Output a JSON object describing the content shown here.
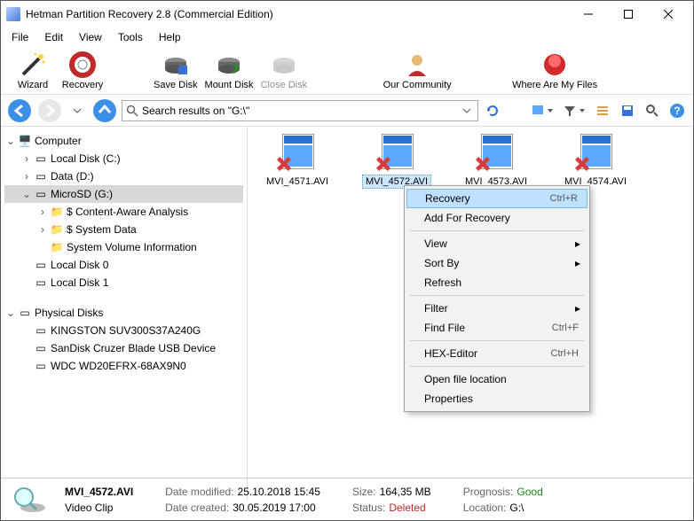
{
  "window": {
    "title": "Hetman Partition Recovery 2.8 (Commercial Edition)"
  },
  "menu": {
    "file": "File",
    "edit": "Edit",
    "view": "View",
    "tools": "Tools",
    "help": "Help"
  },
  "ribbon": {
    "wizard": "Wizard",
    "recovery": "Recovery",
    "savedisk": "Save Disk",
    "mountdisk": "Mount Disk",
    "closedisk": "Close Disk",
    "community": "Our Community",
    "where": "Where Are My Files"
  },
  "address": {
    "text": "Search results on \"G:\\\""
  },
  "tree": {
    "computer": "Computer",
    "localc": "Local Disk (C:)",
    "datad": "Data (D:)",
    "microsd": "MicroSD (G:)",
    "contentaware": "$ Content-Aware Analysis",
    "systemdata": "$ System Data",
    "svi": "System Volume Information",
    "ld0": "Local Disk 0",
    "ld1": "Local Disk 1",
    "physical": "Physical Disks",
    "kingston": "KINGSTON SUV300S37A240G",
    "sandisk": "SanDisk Cruzer Blade USB Device",
    "wdc": "WDC WD20EFRX-68AX9N0"
  },
  "files": [
    {
      "name": "MVI_4571.AVI"
    },
    {
      "name": "MVI_4572.AVI"
    },
    {
      "name": "MVI_4573.AVI"
    },
    {
      "name": "MVI_4574.AVI"
    }
  ],
  "ctx": {
    "recovery": "Recovery",
    "recovery_acc": "Ctrl+R",
    "addrec": "Add For Recovery",
    "view": "View",
    "sortby": "Sort By",
    "refresh": "Refresh",
    "filter": "Filter",
    "findfile": "Find File",
    "findfile_acc": "Ctrl+F",
    "hex": "HEX-Editor",
    "hex_acc": "Ctrl+H",
    "openloc": "Open file location",
    "props": "Properties"
  },
  "status": {
    "name": "MVI_4572.AVI",
    "type": "Video Clip",
    "modlabel": "Date modified:",
    "modval": "25.10.2018 15:45",
    "crlabel": "Date created:",
    "crval": "30.05.2019 17:00",
    "sizelabel": "Size:",
    "sizeval": "164,35 MB",
    "statuslabel": "Status:",
    "statusval": "Deleted",
    "proglabel": "Prognosis:",
    "progval": "Good",
    "loclabel": "Location:",
    "locval": "G:\\"
  }
}
